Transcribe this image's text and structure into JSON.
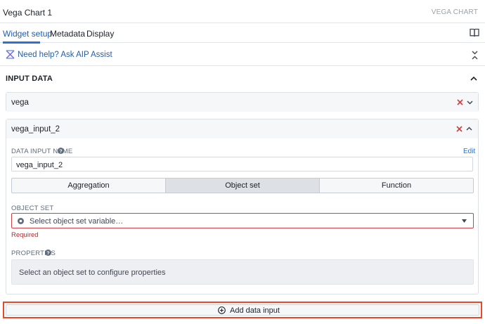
{
  "header": {
    "title": "Vega Chart 1",
    "widget_type": "VEGA CHART"
  },
  "tabs": [
    {
      "label": "Widget setup",
      "active": true
    },
    {
      "label": "Metadata",
      "active": false
    },
    {
      "label": "Display",
      "active": false
    }
  ],
  "help": {
    "label": "Need help? Ask AIP Assist"
  },
  "section": {
    "title": "INPUT DATA"
  },
  "inputs": [
    {
      "name": "vega",
      "expanded": false
    },
    {
      "name": "vega_input_2",
      "expanded": true,
      "data_input_name_label": "DATA INPUT NAME",
      "edit_label": "Edit",
      "data_input_name_value": "vega_input_2",
      "source_options": [
        {
          "label": "Aggregation",
          "active": false
        },
        {
          "label": "Object set",
          "active": true
        },
        {
          "label": "Function",
          "active": false
        }
      ],
      "object_set_label": "OBJECT SET",
      "object_set_placeholder": "Select object set variable…",
      "required_text": "Required",
      "properties_label": "PROPERTIES",
      "properties_hint": "Select an object set to configure properties"
    }
  ],
  "add_button": {
    "label": "Add data input"
  },
  "colors": {
    "accent": "#2d72d2",
    "link": "#215db0",
    "error": "#cd4246",
    "highlight": "#e8492a"
  },
  "icons": [
    "book-icon",
    "aip-assist-icon",
    "collapse-icon",
    "chevron-up-icon",
    "chevron-down-icon",
    "remove-icon",
    "help-circle-icon",
    "object-set-icon",
    "caret-down-icon",
    "add-circle-icon"
  ]
}
